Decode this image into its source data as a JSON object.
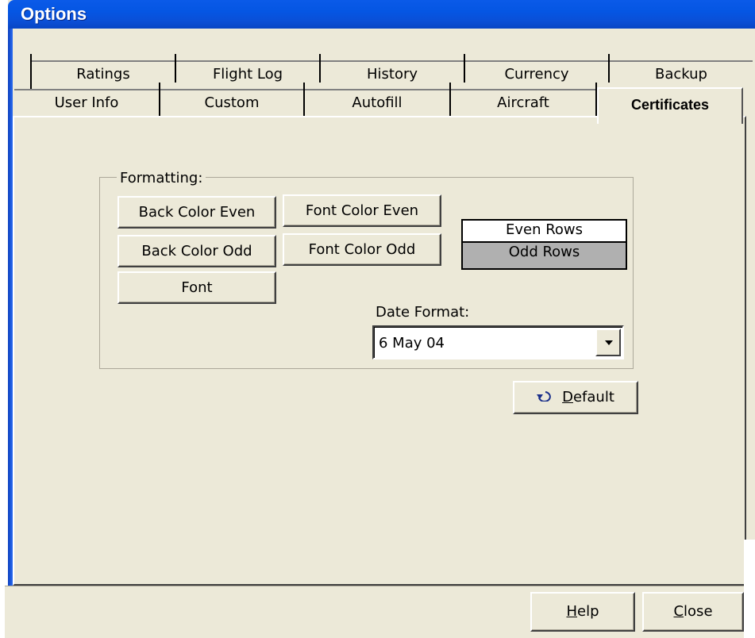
{
  "window": {
    "title": "Options"
  },
  "tabs": {
    "row1": [
      "Ratings",
      "Flight Log",
      "History",
      "Currency",
      "Backup"
    ],
    "row2": [
      "User Info",
      "Custom",
      "Autofill",
      "Aircraft",
      "Certificates"
    ],
    "selected": "Certificates"
  },
  "formatting": {
    "group_label": "Formatting:",
    "back_color_even": "Back Color Even",
    "font_color_even": "Font Color Even",
    "back_color_odd": "Back Color Odd",
    "font_color_odd": "Font Color Odd",
    "font": "Font",
    "preview_even": "Even Rows",
    "preview_odd": "Odd Rows",
    "even_color": "#ffffff",
    "odd_color": "#b0b0b0",
    "date_format_label": "Date Format:",
    "date_format_value": "6 May 04"
  },
  "actions": {
    "default_accel": "D",
    "default_rest": "efault",
    "help_accel": "H",
    "help_rest": "elp",
    "close_accel": "C",
    "close_rest": "lose"
  },
  "icons": {
    "default": "undo-arrow-icon",
    "dropdown": "dropdown-arrow-icon"
  }
}
